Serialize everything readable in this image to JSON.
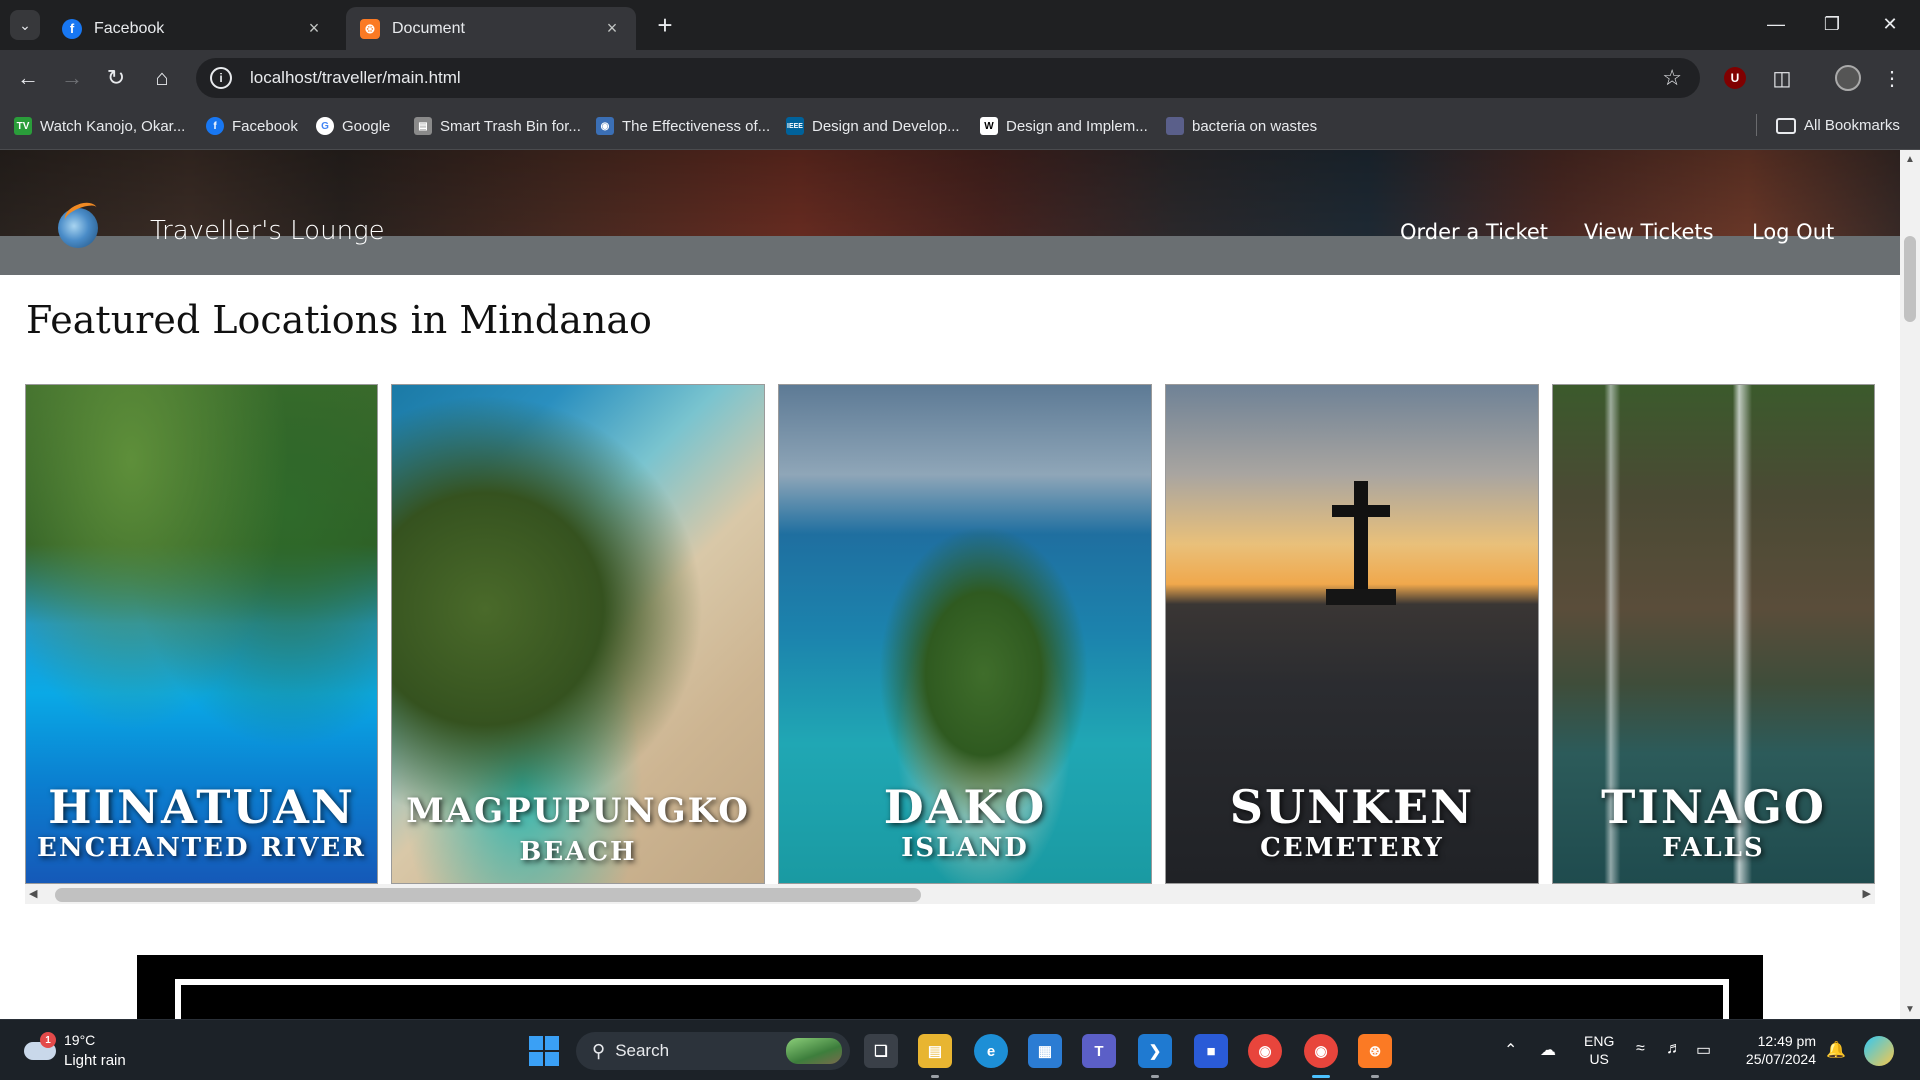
{
  "browser": {
    "tabs": [
      {
        "title": "Facebook",
        "favicon": "facebook-favicon",
        "active": false
      },
      {
        "title": "Document",
        "favicon": "xampp-favicon",
        "active": true
      }
    ],
    "url": "localhost/traveller/main.html",
    "bookmarks": [
      {
        "label": "Watch Kanojo, Okar...",
        "icon": "tv-icon",
        "color": "#2a9d3a"
      },
      {
        "label": "Facebook",
        "icon": "facebook-icon",
        "color": "#1877f2"
      },
      {
        "label": "Google",
        "icon": "google-icon",
        "color": "#ffffff"
      },
      {
        "label": "Smart Trash Bin for...",
        "icon": "doc-icon",
        "color": "#8a8a8a"
      },
      {
        "label": "The Effectiveness of...",
        "icon": "globe-icon",
        "color": "#3b6fb5"
      },
      {
        "label": "Design and Develop...",
        "icon": "ieee-icon",
        "color": "#00629b"
      },
      {
        "label": "Design and Implem...",
        "icon": "wikipedia-icon",
        "color": "#000000"
      },
      {
        "label": "bacteria on wastes",
        "icon": "page-icon",
        "color": "#5a5f8a"
      }
    ],
    "all_bookmarks_label": "All Bookmarks"
  },
  "site": {
    "brand": "Traveller's Lounge",
    "nav": [
      "Order a Ticket",
      "View Tickets",
      "Log Out"
    ],
    "featured_title": "Featured Locations in Mindanao",
    "locations": [
      {
        "main": "HINATUAN",
        "sub": "ENCHANTED RIVER"
      },
      {
        "main": "MAGPUPUNGKO",
        "sub": "BEACH"
      },
      {
        "main": "DAKO",
        "sub": "ISLAND"
      },
      {
        "main": "SUNKEN",
        "sub": "CEMETERY"
      },
      {
        "main": "TINAGO",
        "sub": "FALLS"
      }
    ]
  },
  "taskbar": {
    "weather_temp": "19°C",
    "weather_desc": "Light rain",
    "weather_badge": "1",
    "search_label": "Search",
    "lang_top": "ENG",
    "lang_bottom": "US",
    "time": "12:49 pm",
    "date": "25/07/2024"
  }
}
